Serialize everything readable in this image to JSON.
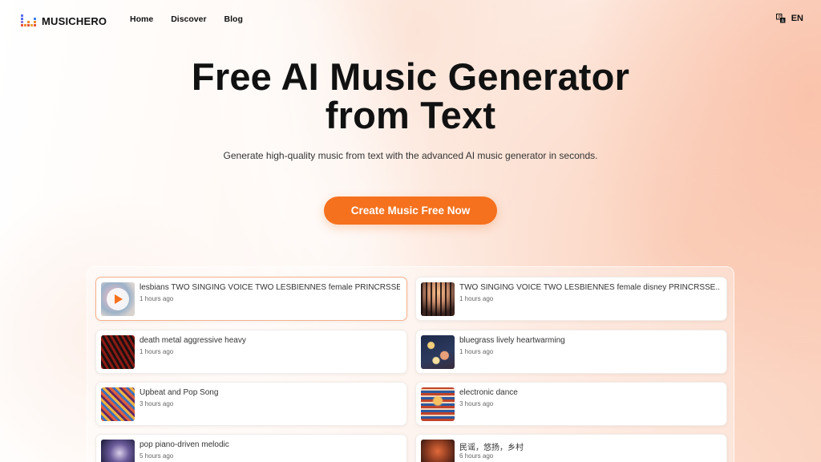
{
  "brand": {
    "name": "MUSICHERO"
  },
  "nav": {
    "home": "Home",
    "discover": "Discover",
    "blog": "Blog"
  },
  "language": {
    "icon": "translate-icon",
    "label": "EN"
  },
  "hero": {
    "title_line1": "Free AI Music Generator",
    "title_line2": "from Text",
    "subtitle": "Generate high-quality music from text with the advanced AI music generator in seconds.",
    "cta_label": "Create Music Free Now"
  },
  "colors": {
    "accent": "#f5711d",
    "active_border": "#f7b08a"
  },
  "songs": [
    {
      "title": "lesbians TWO SINGING VOICE TWO LESBIENNES female PRINCRSSE...",
      "time": "1 hours ago",
      "playing": true
    },
    {
      "title": "TWO SINGING VOICE TWO LESBIENNES female disney PRINCRSSE...",
      "time": "1 hours ago"
    },
    {
      "title": "death metal aggressive heavy",
      "time": "1 hours ago"
    },
    {
      "title": "bluegrass lively heartwarming",
      "time": "1 hours ago"
    },
    {
      "title": "Upbeat and Pop Song",
      "time": "3 hours ago"
    },
    {
      "title": "electronic dance",
      "time": "3 hours ago"
    },
    {
      "title": "pop piano-driven melodic",
      "time": "5 hours ago"
    },
    {
      "title": "民谣，悠扬，乡村",
      "time": "6 hours ago"
    }
  ]
}
